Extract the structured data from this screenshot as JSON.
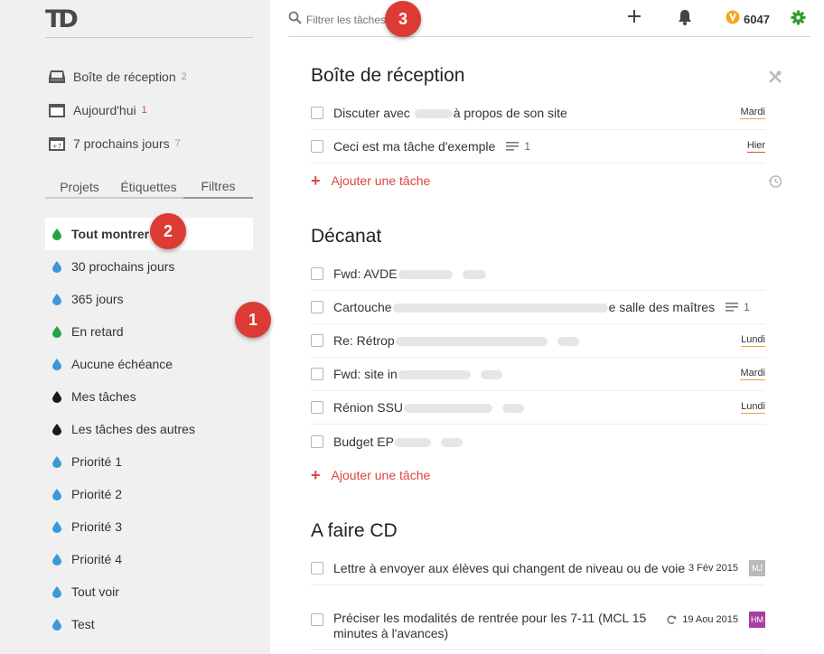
{
  "logo": "TD",
  "sidebar": {
    "nav": [
      {
        "label": "Boîte de réception",
        "count": "2",
        "icon": "inbox-icon"
      },
      {
        "label": "Aujourd'hui",
        "count": "1",
        "icon": "calendar-icon"
      },
      {
        "label": "7 prochains jours",
        "count": "7",
        "icon": "calendar-plus7-icon",
        "icon_text": "+7"
      }
    ],
    "tabs": [
      "Projets",
      "Étiquettes",
      "Filtres"
    ],
    "filters": [
      {
        "label": "Tout montrer",
        "color": "#27a244"
      },
      {
        "label": "30 prochains jours",
        "color": "#3a9ad9"
      },
      {
        "label": "365 jours",
        "color": "#3a9ad9"
      },
      {
        "label": "En retard",
        "color": "#27a244"
      },
      {
        "label": "Aucune échéance",
        "color": "#3a9ad9"
      },
      {
        "label": "Mes tâches",
        "color": "#1a1a1a"
      },
      {
        "label": "Les tâches des autres",
        "color": "#1a1a1a"
      },
      {
        "label": "Priorité 1",
        "color": "#3a9ad9"
      },
      {
        "label": "Priorité 2",
        "color": "#3a9ad9"
      },
      {
        "label": "Priorité 3",
        "color": "#3a9ad9"
      },
      {
        "label": "Priorité 4",
        "color": "#3a9ad9"
      },
      {
        "label": "Tout voir",
        "color": "#3a9ad9"
      },
      {
        "label": "Test",
        "color": "#3a9ad9"
      }
    ]
  },
  "topbar": {
    "search_placeholder": "Filtrer les tâches",
    "karma": "6047"
  },
  "sections": [
    {
      "title": "Boîte de réception",
      "tasks": [
        {
          "before": "Discuter avec",
          "after": "à propos de son site",
          "due": "Mardi"
        },
        {
          "text": "Ceci est ma tâche d'exemple",
          "note_count": "1",
          "due": "Hier"
        }
      ],
      "add_label": "Ajouter une tâche"
    },
    {
      "title": "Décanat",
      "tasks": [
        {
          "text": "Fwd: AVDE"
        },
        {
          "before": "Cartouche",
          "after": "e salle des maîtres",
          "note_count": "1"
        },
        {
          "text": "Re: Rétrop",
          "due": "Lundi"
        },
        {
          "text": "Fwd: site in",
          "due": "Mardi"
        },
        {
          "text": "Rénion SSU",
          "due": "Lundi"
        },
        {
          "text": "Budget EP"
        }
      ],
      "add_label": "Ajouter une tâche"
    },
    {
      "title": "A faire CD",
      "tasks": [
        {
          "text": "Lettre à envoyer aux élèves qui changent de niveau ou de voie",
          "date": "3 Fév 2015",
          "avatar": "MJ",
          "avatar_color": "#b9b9b9"
        },
        {
          "line1": "Préciser les modalités de rentrée pour les 7-11 (MCL 15",
          "line2": "minutes à l'avances)",
          "date": "19 Aou 2015",
          "avatar": "HM",
          "avatar_color": "#a83ea5"
        }
      ]
    }
  ],
  "annotations": [
    "1",
    "2",
    "3"
  ]
}
